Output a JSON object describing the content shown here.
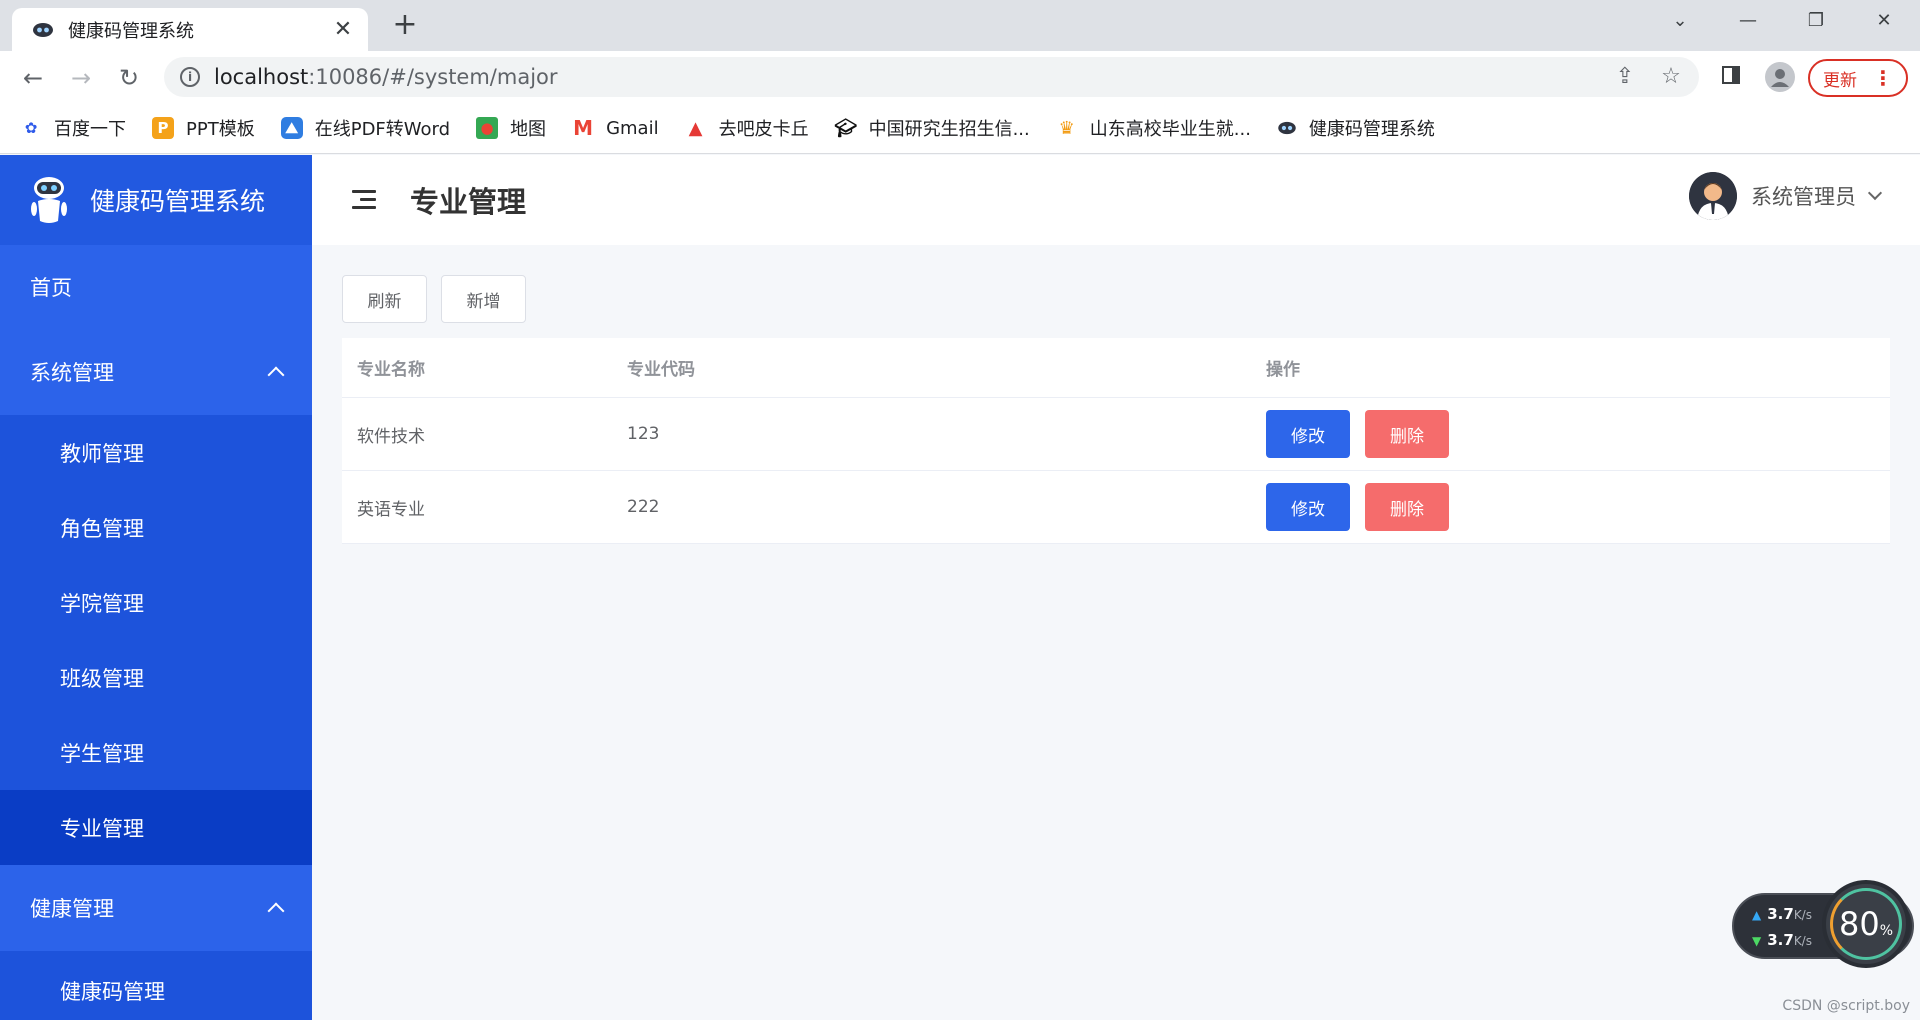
{
  "browser": {
    "tab_title": "健康码管理系统",
    "url_host": "localhost",
    "url_rest": ":10086/#/system/major",
    "update_label": "更新",
    "bookmarks": [
      {
        "label": "百度一下",
        "icon": "baidu-icon"
      },
      {
        "label": "PPT模板",
        "icon": "ppt-icon"
      },
      {
        "label": "在线PDF转Word",
        "icon": "pdf-icon"
      },
      {
        "label": "地图",
        "icon": "maps-icon"
      },
      {
        "label": "Gmail",
        "icon": "gmail-icon"
      },
      {
        "label": "去吧皮卡丘",
        "icon": "watermelon-icon"
      },
      {
        "label": "中国研究生招生信...",
        "icon": "graduation-cap-icon"
      },
      {
        "label": "山东高校毕业生就...",
        "icon": "shandong-logo-icon"
      },
      {
        "label": "健康码管理系统",
        "icon": "robot-icon"
      }
    ]
  },
  "app": {
    "brand_title": "健康码管理系统",
    "menu": {
      "home": "首页",
      "system": {
        "label": "系统管理",
        "items": [
          "教师管理",
          "角色管理",
          "学院管理",
          "班级管理",
          "学生管理",
          "专业管理"
        ]
      },
      "health": {
        "label": "健康管理",
        "items": [
          "健康码管理"
        ]
      }
    },
    "header": {
      "page_title": "专业管理",
      "user_name": "系统管理员"
    },
    "toolbar": {
      "refresh_label": "刷新",
      "add_label": "新增"
    },
    "table": {
      "columns": [
        "专业名称",
        "专业代码",
        "操作"
      ],
      "rows": [
        {
          "name": "软件技术",
          "code": "123"
        },
        {
          "name": "英语专业",
          "code": "222"
        }
      ],
      "edit_label": "修改",
      "delete_label": "删除"
    }
  },
  "overlay": {
    "upload_speed": "3.7",
    "download_speed": "3.7",
    "speed_unit": "K/s",
    "usage_value": "80",
    "usage_unit": "%",
    "watermark": "CSDN @script.boy"
  },
  "colors": {
    "sidebar": "#1f56dc",
    "sidebar_active": "#0a3dc5",
    "primary_button": "#2d66ea",
    "danger_button": "#f56c6c"
  }
}
